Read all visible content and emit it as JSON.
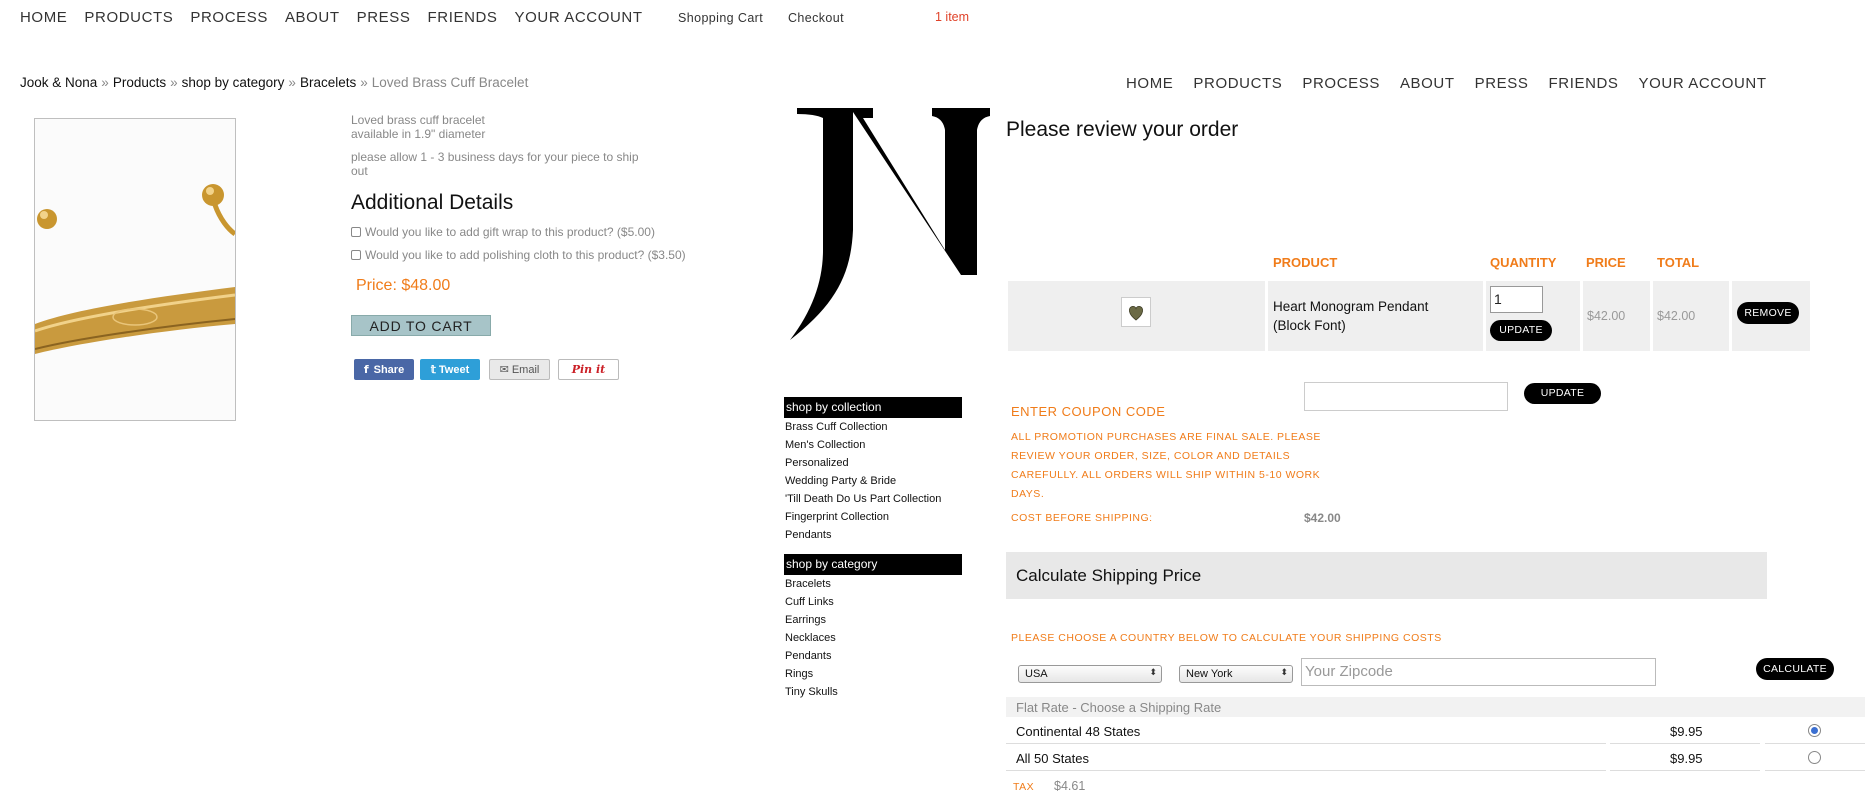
{
  "top_nav": [
    "HOME",
    "PRODUCTS",
    "PROCESS",
    "ABOUT",
    "PRESS",
    "FRIENDS",
    "YOUR ACCOUNT"
  ],
  "cart_links": {
    "shopping_cart": "Shopping Cart",
    "checkout": "Checkout",
    "count": "1 item"
  },
  "breadcrumb": {
    "items": [
      "Jook & Nona",
      "Products",
      "shop by category",
      "Bracelets"
    ],
    "separator": "»",
    "current": "Loved Brass Cuff Bracelet"
  },
  "product": {
    "desc_lines": [
      "Loved brass cuff bracelet",
      "available in 1.9\" diameter"
    ],
    "ship_lines": [
      "please allow 1 - 3 business days for your piece to ship",
      "out"
    ],
    "details_heading": "Additional Details",
    "options": [
      "Would you like to add gift wrap to this product? ($5.00)",
      "Would you like to add polishing cloth to this product? ($3.50)"
    ],
    "price": "Price: $48.00",
    "add_to_cart": "ADD TO CART",
    "share": {
      "facebook": "Share",
      "twitter": "Tweet",
      "email": "Email",
      "pinterest": "Pin it"
    }
  },
  "side": {
    "collection_heading": "shop by collection",
    "collection_items": [
      "Brass Cuff Collection",
      "Men's Collection",
      "Personalized",
      "Wedding Party & Bride",
      "'Till Death Do Us Part Collection",
      "Fingerprint Collection",
      "Pendants"
    ],
    "category_heading": "shop by category",
    "category_items": [
      "Bracelets",
      "Cuff Links",
      "Earrings",
      "Necklaces",
      "Pendants",
      "Rings",
      "Tiny Skulls"
    ]
  },
  "right_nav": [
    "HOME",
    "PRODUCTS",
    "PROCESS",
    "ABOUT",
    "PRESS",
    "FRIENDS",
    "YOUR ACCOUNT"
  ],
  "review": {
    "title": "Please review your order",
    "headers": {
      "product": "PRODUCT",
      "quantity": "QUANTITY",
      "price": "PRICE",
      "total": "TOTAL"
    },
    "item": {
      "name": "Heart Monogram Pendant (Block Font)",
      "qty": "1",
      "price": "$42.00",
      "total": "$42.00"
    },
    "update_label": "UPDATE",
    "remove_label": "REMOVE",
    "coupon_label": "ENTER COUPON CODE",
    "coupon_button": "UPDATE",
    "promo_lines": [
      "ALL PROMOTION PURCHASES ARE FINAL SALE. PLEASE",
      "REVIEW YOUR ORDER, SIZE, COLOR AND DETAILS",
      "CAREFULLY. ALL ORDERS WILL SHIP WITHIN 5-10 WORK",
      "DAYS."
    ],
    "cost_label": "COST BEFORE SHIPPING:",
    "cost_value": "$42.00"
  },
  "shipping": {
    "title": "Calculate Shipping Price",
    "prompt": "PLEASE CHOOSE A COUNTRY BELOW TO CALCULATE YOUR SHIPPING COSTS",
    "country": "USA",
    "state": "New York",
    "zip_placeholder": "Your Zipcode",
    "calculate_label": "CALCULATE",
    "rate_heading": "Flat Rate - Choose a Shipping Rate",
    "rates": [
      {
        "name": "Continental 48 States",
        "price": "$9.95",
        "selected": true
      },
      {
        "name": "All 50 States",
        "price": "$9.95",
        "selected": false
      }
    ],
    "tax_label": "TAX",
    "tax_value": "$4.61"
  },
  "colors": {
    "accent_orange": "#f07c1a",
    "button_black": "#000000",
    "add_cart_bg": "#a7c4c8",
    "radio_selected": "#3b6fd1"
  }
}
